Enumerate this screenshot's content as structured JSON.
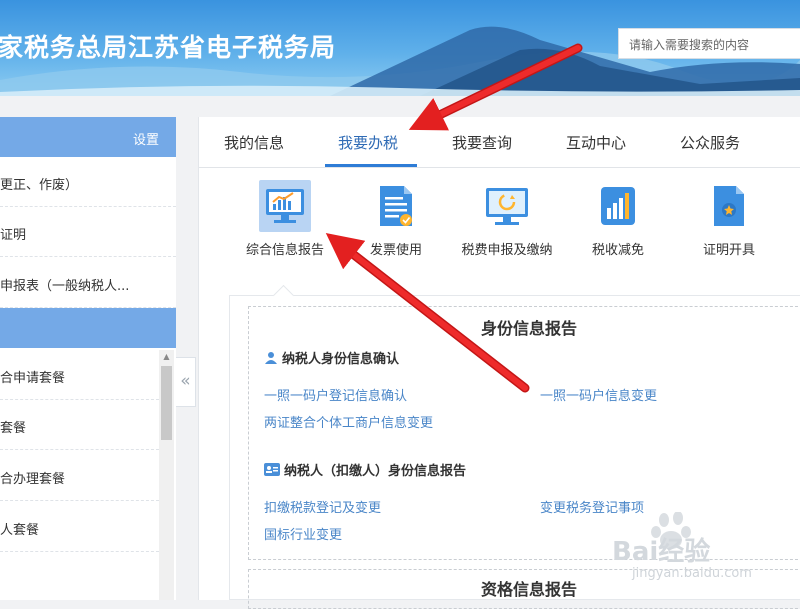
{
  "header": {
    "site_title": "家税务总局江苏省电子税务局",
    "search_placeholder": "请输入需要搜索的内容"
  },
  "sidebar": {
    "settings_label": "设置",
    "items": [
      {
        "label": "更正、作废）"
      },
      {
        "label": "证明"
      },
      {
        "label": "申报表（一般纳税人..."
      },
      {
        "label": "合申请套餐"
      },
      {
        "label": "套餐"
      },
      {
        "label": "合办理套餐"
      },
      {
        "label": "人套餐"
      }
    ]
  },
  "tabs": [
    {
      "label": "我的信息"
    },
    {
      "label": "我要办税",
      "active": true
    },
    {
      "label": "我要查询"
    },
    {
      "label": "互动中心"
    },
    {
      "label": "公众服务"
    }
  ],
  "functions": [
    {
      "label": "综合信息报告",
      "icon": "monitor-chart-icon",
      "selected": true
    },
    {
      "label": "发票使用",
      "icon": "invoice-doc-icon"
    },
    {
      "label": "税费申报及缴纳",
      "icon": "monitor-refresh-icon"
    },
    {
      "label": "税收减免",
      "icon": "bar-chart-icon"
    },
    {
      "label": "证明开具",
      "icon": "certificate-doc-icon"
    }
  ],
  "identity_section": {
    "title": "身份信息报告",
    "group1": {
      "title": "纳税人身份信息确认",
      "links": [
        "一照一码户登记信息确认",
        "一照一码户信息变更",
        "两证整合个体工商户信息变更"
      ]
    },
    "group2": {
      "title": "纳税人（扣缴人）身份信息报告",
      "links": [
        "扣缴税款登记及变更",
        "变更税务登记事项",
        "国标行业变更"
      ]
    }
  },
  "qualification_section": {
    "title": "资格信息报告"
  },
  "watermark": {
    "text": "Bai经验",
    "url": "jingyan.baidu.com"
  },
  "colors": {
    "accent": "#2e7cd6",
    "sidebar_band": "#74a9e7",
    "link": "#4a86c8",
    "arrow": "#e32020"
  }
}
